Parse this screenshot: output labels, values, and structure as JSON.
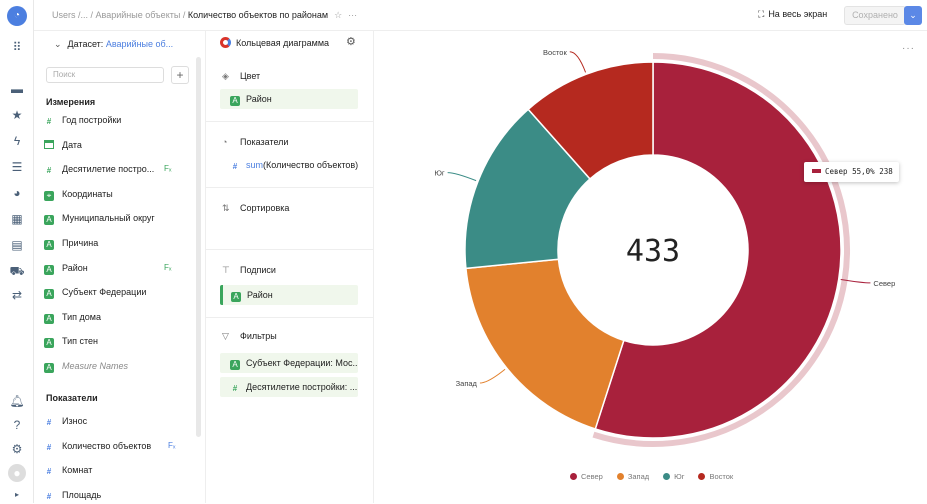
{
  "breadcrumb": {
    "path": "Users /... / Аварийные объекты / ",
    "current": "Количество объектов по районам",
    "star": "☆",
    "more": "···"
  },
  "topbar": {
    "fullscreen_label": "На весь экран",
    "saved_label": "Сохранено",
    "dropdown_icon": "chevron-down-icon"
  },
  "dataset": {
    "label": "Датасет:",
    "name": "Аварийные об...",
    "search_placeholder": "Поиск",
    "add_label": "+",
    "dimensions_title": "Измерения",
    "dimensions": [
      {
        "label": "Год постройки",
        "icon": "#",
        "type": "num",
        "badge": ""
      },
      {
        "label": "Дата",
        "icon": "date",
        "type": "date",
        "badge": ""
      },
      {
        "label": "Десятилетие постро...",
        "icon": "#",
        "type": "num",
        "badge": "Fₓ"
      },
      {
        "label": "Координаты",
        "icon": "geo",
        "type": "box",
        "badge": ""
      },
      {
        "label": "Муниципальный округ",
        "icon": "A",
        "type": "box",
        "badge": ""
      },
      {
        "label": "Причина",
        "icon": "A",
        "type": "box",
        "badge": ""
      },
      {
        "label": "Район",
        "icon": "A",
        "type": "box",
        "badge": "Fₓ"
      },
      {
        "label": "Субъект Федерации",
        "icon": "A",
        "type": "box",
        "badge": ""
      },
      {
        "label": "Тип дома",
        "icon": "A",
        "type": "box",
        "badge": ""
      },
      {
        "label": "Тип стен",
        "icon": "A",
        "type": "box",
        "badge": ""
      },
      {
        "label": "Measure Names",
        "icon": "A",
        "type": "box",
        "badge": "",
        "italic": true
      }
    ],
    "measures_title": "Показатели",
    "measures": [
      {
        "label": "Износ",
        "badge": ""
      },
      {
        "label": "Количество объектов",
        "badge": "Fₓ"
      },
      {
        "label": "Комнат",
        "badge": ""
      },
      {
        "label": "Площадь",
        "badge": ""
      }
    ]
  },
  "wizard": {
    "chart_type": "Кольцевая диаграмма",
    "color_section": "Цвет",
    "color_field": "Район",
    "measures_section": "Показатели",
    "measure_fn": "sum",
    "measure_field": "(Количество объектов)",
    "sort_section": "Сортировка",
    "labels_section": "Подписи",
    "labels_field": "Район",
    "filters_section": "Фильтры",
    "filters": [
      "Субъект Федерации: Мос...",
      "Десятилетие постройки: ..."
    ]
  },
  "colors": {
    "sever": "#a8213c",
    "zapad": "#e2812d",
    "yug": "#3b8c86",
    "vostok": "#b5291f",
    "accent": "#4c7fe0",
    "dim_green": "#3aa55c"
  },
  "chart_data": {
    "type": "pie",
    "donut": true,
    "total_label": "433",
    "categories": [
      "Север",
      "Запад",
      "Юг",
      "Восток"
    ],
    "values": [
      238,
      80,
      65,
      50
    ],
    "tooltip": {
      "category": "Север",
      "percent": "55,0%",
      "value": "238"
    },
    "legend_position": "bottom"
  }
}
